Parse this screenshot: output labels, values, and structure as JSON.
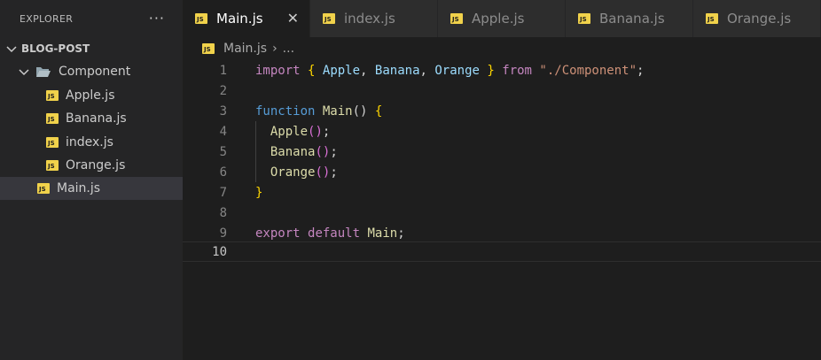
{
  "explorer": {
    "title": "EXPLORER",
    "more": "···",
    "root": "BLOG-POST",
    "folder": "Component",
    "files_in_folder": [
      "Apple.js",
      "Banana.js",
      "index.js",
      "Orange.js"
    ],
    "root_file": "Main.js",
    "js_icon_text": "JS"
  },
  "tabs": [
    {
      "label": "Main.js",
      "close": "✕"
    },
    {
      "label": "index.js"
    },
    {
      "label": "Apple.js"
    },
    {
      "label": "Banana.js"
    },
    {
      "label": "Orange.js"
    }
  ],
  "breadcrumb": {
    "file": "Main.js",
    "sep": "›",
    "rest": "..."
  },
  "editor": {
    "line_numbers": [
      "1",
      "2",
      "3",
      "4",
      "5",
      "6",
      "7",
      "8",
      "9",
      "10"
    ],
    "tokens": {
      "import": "import",
      "lbrace": "{",
      "apple": "Apple",
      "comma": ",",
      "banana": "Banana",
      "orange": "Orange",
      "rbrace": "}",
      "from": "from",
      "path": "\"./Component\"",
      "semi": ";",
      "function": "function",
      "main": "Main",
      "parens": "()",
      "lparen": "(",
      "rparen": ")",
      "export": "export",
      "default": "default"
    }
  },
  "colors": {
    "js_icon": "#f1d24b",
    "keyword": "#c586c0",
    "storage": "#569cd6",
    "identifier": "#9cdcfe",
    "function": "#dcdcaa",
    "string": "#ce9178",
    "bracket_level1": "#ffd700",
    "bracket_level2": "#da70d6"
  }
}
